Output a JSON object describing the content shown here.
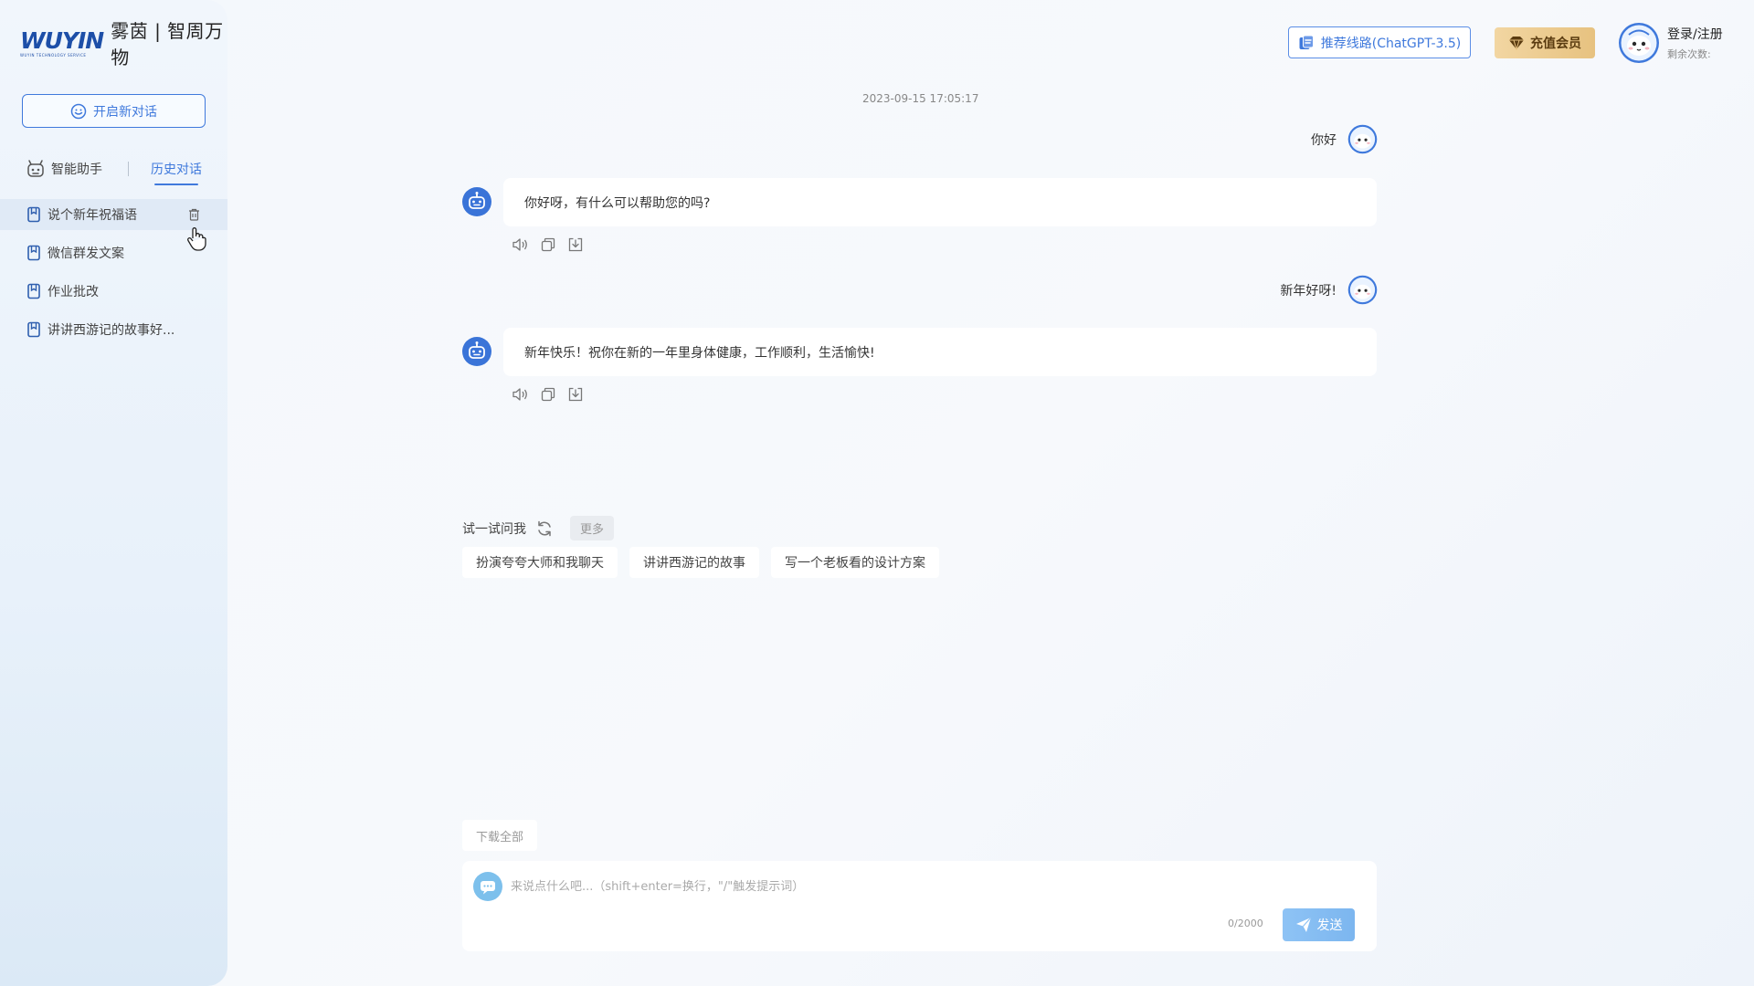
{
  "brand": {
    "logo_word": "WUYIN",
    "logo_tagline": "WUYIN TECHNOLOGY SERVICE",
    "name": "雾茵 | 智周万物"
  },
  "sidebar": {
    "new_chat_label": "开启新对话",
    "tab_assistant": "智能助手",
    "tab_history": "历史对话",
    "history": [
      {
        "label": "说个新年祝福语"
      },
      {
        "label": "微信群发文案"
      },
      {
        "label": "作业批改"
      },
      {
        "label": "讲讲西游记的故事好..."
      }
    ]
  },
  "header": {
    "route_label": "推荐线路(ChatGPT-3.5)",
    "vip_label": "充值会员",
    "login_label": "登录/注册",
    "remaining_label": "剩余次数:"
  },
  "chat": {
    "timestamp": "2023-09-15 17:05:17",
    "messages": [
      {
        "role": "user",
        "text": "你好"
      },
      {
        "role": "bot",
        "text": "你好呀，有什么可以帮助您的吗?"
      },
      {
        "role": "user",
        "text": "新年好呀!"
      },
      {
        "role": "bot",
        "text": "新年快乐！祝你在新的一年里身体健康，工作顺利，生活愉快!"
      }
    ]
  },
  "suggestions": {
    "label": "试一试问我",
    "more_label": "更多",
    "chips": [
      "扮演夸夸大师和我聊天",
      "讲讲西游记的故事",
      "写一个老板看的设计方案"
    ]
  },
  "composer": {
    "download_all_label": "下载全部",
    "placeholder": "来说点什么吧...（shift+enter=换行，\"/\"触发提示词）",
    "value": "",
    "counter": "0/2000",
    "send_label": "发送"
  },
  "colors": {
    "accent": "#3f79dc",
    "vip_gold": "#e9c685",
    "send": "#84bbf2"
  }
}
